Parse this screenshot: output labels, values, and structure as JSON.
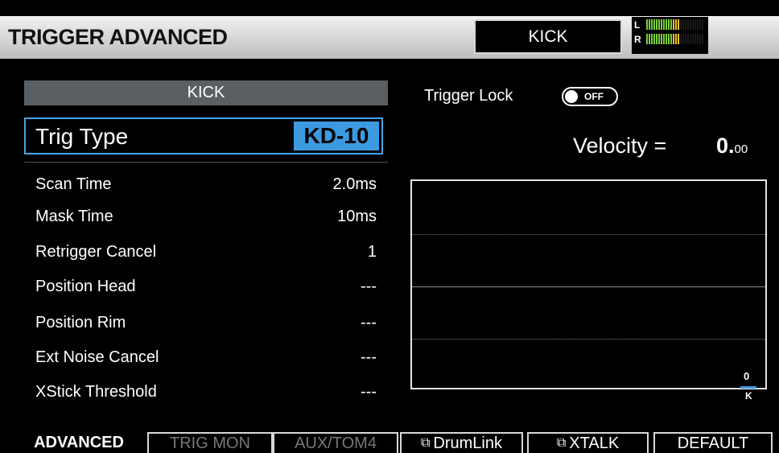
{
  "header": {
    "title": "TRIGGER ADVANCED",
    "instrument": "KICK",
    "meter": {
      "left_label": "L",
      "right_label": "R",
      "left_level": 0.58,
      "right_level": 0.58
    }
  },
  "left_panel": {
    "pad_name": "KICK",
    "trig_type": {
      "label": "Trig Type",
      "value": "KD-10"
    },
    "params": [
      {
        "label": "Scan Time",
        "value": "2.0ms"
      },
      {
        "label": "Mask Time",
        "value": "10ms"
      },
      {
        "label": "Retrigger Cancel",
        "value": "1"
      },
      {
        "label": "Position Head",
        "value": "---"
      },
      {
        "label": "Position Rim",
        "value": "---"
      },
      {
        "label": "Ext Noise Cancel",
        "value": "---"
      },
      {
        "label": "XStick Threshold",
        "value": "---"
      }
    ]
  },
  "right_panel": {
    "trigger_lock": {
      "label": "Trigger Lock",
      "state": "OFF"
    },
    "velocity": {
      "label": "Velocity =",
      "value": "0.",
      "decimal": "00"
    },
    "graph": {
      "bar_value": "0",
      "bar_label": "K"
    }
  },
  "tabs": [
    {
      "label": "ADVANCED"
    },
    {
      "label": "TRIG MON"
    },
    {
      "label": "AUX/TOM4"
    },
    {
      "label": "DrumLink",
      "icon": "external-link-icon"
    },
    {
      "label": "XTALK",
      "icon": "external-link-icon"
    },
    {
      "label": "DEFAULT"
    }
  ],
  "colors": {
    "accent": "#3c9be0",
    "meter_green": "#7ccf3c",
    "meter_yellow": "#f0c020"
  }
}
